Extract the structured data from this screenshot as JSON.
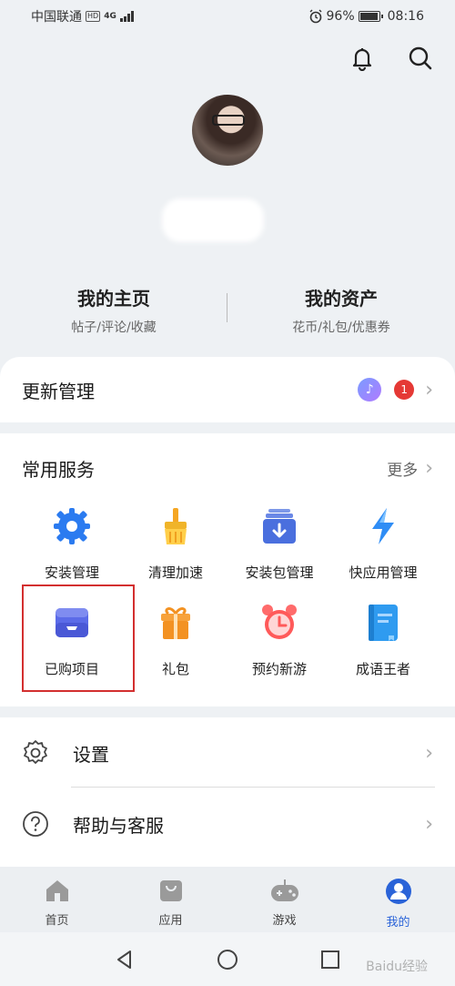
{
  "status_bar": {
    "carrier": "中国联通",
    "hd": "HD",
    "network": "4G",
    "battery": "96%",
    "battery_level": 0.96,
    "time": "08:16"
  },
  "header": {
    "icons": [
      "bell-icon",
      "search-icon"
    ]
  },
  "profile": {
    "home": {
      "title": "我的主页",
      "sub": "帖子/评论/收藏"
    },
    "assets": {
      "title": "我的资产",
      "sub": "花币/礼包/优惠券"
    }
  },
  "update": {
    "label": "更新管理",
    "badge_count": "1"
  },
  "services": {
    "title": "常用服务",
    "more": "更多",
    "items": [
      {
        "label": "安装管理",
        "icon": "gear-icon"
      },
      {
        "label": "清理加速",
        "icon": "broom-icon"
      },
      {
        "label": "安装包管理",
        "icon": "package-download-icon"
      },
      {
        "label": "快应用管理",
        "icon": "lightning-icon"
      },
      {
        "label": "已购项目",
        "icon": "wallet-icon"
      },
      {
        "label": "礼包",
        "icon": "gift-icon"
      },
      {
        "label": "预约新游",
        "icon": "alarm-clock-icon"
      },
      {
        "label": "成语王者",
        "icon": "book-icon"
      }
    ]
  },
  "menu": [
    {
      "label": "设置",
      "icon": "settings-icon"
    },
    {
      "label": "帮助与客服",
      "icon": "help-icon"
    }
  ],
  "bottom_nav": [
    {
      "label": "首页",
      "icon": "home-icon",
      "active": false
    },
    {
      "label": "应用",
      "icon": "shopping-bag-icon",
      "active": false
    },
    {
      "label": "游戏",
      "icon": "gamepad-icon",
      "active": false
    },
    {
      "label": "我的",
      "icon": "user-icon",
      "active": true
    }
  ],
  "colors": {
    "accent": "#2a63d8",
    "badge": "#e53935",
    "highlight": "#d32f2f"
  },
  "watermark": "Baidu经验"
}
